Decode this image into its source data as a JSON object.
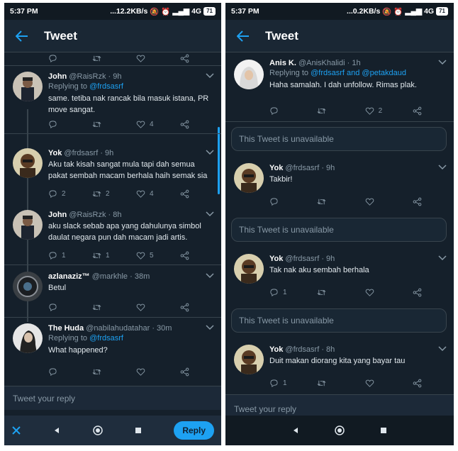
{
  "left": {
    "status": {
      "time": "5:37 PM",
      "speed": "...12.2KB/s",
      "network": "4G",
      "battery": "71"
    },
    "title": "Tweet",
    "tweets": [
      {
        "name": "John",
        "handle": "@RaisRzk",
        "time": "· 9h",
        "replying_label": "Replying to",
        "mention": "@frdsasrf",
        "text": "same. tetiba nak rancak bila masuk istana, PR move sangat.",
        "replies": "",
        "retweets": "",
        "likes": "4"
      },
      {
        "name": "Yok",
        "handle": "@frdsasrf",
        "time": "· 9h",
        "text": "Aku tak kisah sangat mula tapi dah semua pakat sembah macam berhala haih semak sia",
        "replies": "2",
        "retweets": "2",
        "likes": "4"
      },
      {
        "name": "John",
        "handle": "@RaisRzk",
        "time": "· 8h",
        "text": "aku slack sebab apa yang dahulunya simbol daulat negara pun dah macam jadi artis.",
        "replies": "1",
        "retweets": "1",
        "likes": "5"
      },
      {
        "name": "azlanaziz™",
        "handle": "@markhle",
        "time": "· 38m",
        "text": "Betul",
        "replies": "",
        "retweets": "",
        "likes": ""
      },
      {
        "name": "The Huda",
        "handle": "@nabilahudatahar",
        "time": "· 30m",
        "replying_label": "Replying to",
        "mention": "@frdsasrf",
        "text": "What happened?",
        "replies": "",
        "retweets": "",
        "likes": ""
      }
    ],
    "reply_placeholder": "Tweet your reply",
    "reply_button": "Reply"
  },
  "right": {
    "status": {
      "time": "5:37 PM",
      "speed": "...0.2KB/s",
      "network": "4G",
      "battery": "71"
    },
    "title": "Tweet",
    "tweets": [
      {
        "name": "Anis K.",
        "handle": "@AnisKhalidi",
        "time": "· 1h",
        "replying_label": "Replying to",
        "mention": "@frdsasrf and @petakdaud",
        "text": "Haha samalah. I dah unfollow. Rimas plak.",
        "replies": "",
        "retweets": "",
        "likes": "2"
      },
      {
        "name": "Yok",
        "handle": "@frdsasrf",
        "time": "· 9h",
        "text": "Takbir!",
        "replies": "",
        "retweets": "",
        "likes": ""
      },
      {
        "name": "Yok",
        "handle": "@frdsasrf",
        "time": "· 9h",
        "text": "Tak nak aku sembah berhala",
        "replies": "1",
        "retweets": "",
        "likes": ""
      },
      {
        "name": "Yok",
        "handle": "@frdsasrf",
        "time": "· 8h",
        "text": "Duit makan diorang kita yang bayar tau",
        "replies": "1",
        "retweets": "",
        "likes": ""
      }
    ],
    "unavailable_text": "This Tweet is unavailable",
    "reply_placeholder": "Tweet your reply"
  },
  "colors": {
    "background": "#15202b",
    "accent": "#1da1f2",
    "border": "#38444d",
    "muted": "#8899a6"
  }
}
